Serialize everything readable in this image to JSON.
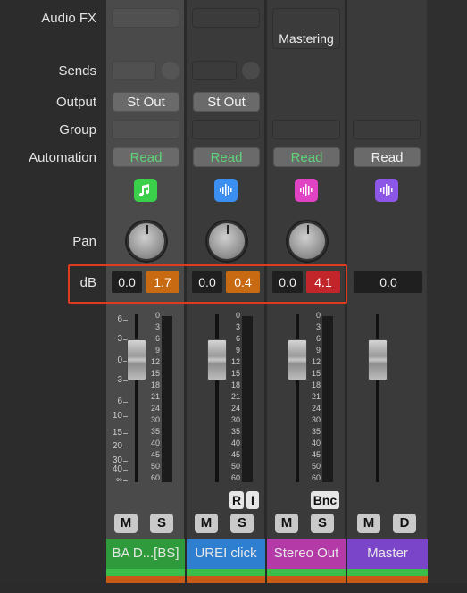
{
  "labels": {
    "audio_fx": "Audio FX",
    "sends": "Sends",
    "output": "Output",
    "group": "Group",
    "automation": "Automation",
    "pan": "Pan",
    "db": "dB"
  },
  "channels": [
    {
      "name": "BA D...[BS]",
      "output": "St Out",
      "automation": "Read",
      "icon": "music-note-icon",
      "icon_color": "#3bd04a",
      "db_volume": "0.0",
      "db_peak": "1.7",
      "peak_color": "#c76a12",
      "mute": "M",
      "solo": "S",
      "name_color": "#2f9a3c",
      "bar_color": "#3bbd4a",
      "selected": true
    },
    {
      "name": "UREI click",
      "output": "St Out",
      "automation": "Read",
      "icon": "waveform-icon",
      "icon_color": "#3a8ff0",
      "db_volume": "0.0",
      "db_peak": "0.4",
      "peak_color": "#c76a12",
      "mute": "M",
      "solo": "S",
      "extra_buttons": [
        "R",
        "I"
      ],
      "name_color": "#2f7fd0",
      "bar_color": "#3bbd4a",
      "selected": false
    },
    {
      "name": "Stereo Out",
      "audio_fx": "Mastering",
      "automation": "Read",
      "icon": "waveform-icon",
      "icon_color": "#e043c4",
      "db_volume": "0.0",
      "db_peak": "4.1",
      "peak_color": "#c2262b",
      "mute": "M",
      "solo": "S",
      "extra_buttons": [
        "Bnc"
      ],
      "name_color": "#b43aa8",
      "bar_color": "#3bbd4a",
      "selected": false
    },
    {
      "name": "Master",
      "automation": "Read",
      "icon": "waveform-icon",
      "icon_color": "#8c56e6",
      "db_volume": "0.0",
      "mute": "M",
      "solo": "D",
      "name_color": "#7b45c9",
      "bar_color": "#3bbd4a",
      "selected": false
    }
  ],
  "fader_scale": [
    "6",
    "3",
    "0",
    "3",
    "6",
    "10",
    "15",
    "20",
    "30",
    "40",
    "∞"
  ],
  "meter_scale": [
    "0",
    "3",
    "6",
    "9",
    "12",
    "15",
    "18",
    "21",
    "24",
    "30",
    "35",
    "40",
    "45",
    "50",
    "60"
  ],
  "highlight_color": "#e03a1f"
}
